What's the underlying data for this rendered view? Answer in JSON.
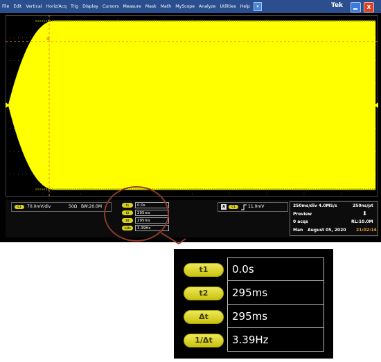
{
  "menu": {
    "items": [
      "File",
      "Edit",
      "Vertical",
      "Horiz/Acq",
      "Trig",
      "Display",
      "Cursors",
      "Measure",
      "Mask",
      "Math",
      "MyScope",
      "Analyze",
      "Utilities",
      "Help"
    ],
    "brand": "Tek",
    "close_glyph": "X"
  },
  "channel": {
    "badge": "C1",
    "scale": "70.0mV/div",
    "impedance": "50Ω",
    "bandwidth": "BW:20.0M"
  },
  "trigger": {
    "mode_badge": "A",
    "source_badge": "C1",
    "level": "11.0mV"
  },
  "acquisition": {
    "timebase": "250ms/div  4.0MS/s",
    "resolution": "250ns/pt",
    "mode": "Preview",
    "acqs": "0 acqs",
    "record_length": "RL:10.0M",
    "state": "Man",
    "date": "August 05, 2020",
    "time": "21:02:14"
  },
  "cursors": [
    {
      "label": "t1",
      "value": "0.0s"
    },
    {
      "label": "t2",
      "value": "295ms"
    },
    {
      "label": "Δt",
      "value": "295ms"
    },
    {
      "label": "1/Δt",
      "value": "3.39Hz"
    }
  ],
  "colors": {
    "trace": "#ffff00",
    "menu_bar": "#2b4f8e",
    "cursor_line": "#e98a24",
    "callout": "#8c3a2a"
  },
  "icons": [
    "minimize-icon",
    "close-icon",
    "dropdown-arrow-icon",
    "trigger-rising-edge-icon",
    "cursor-marker-icon",
    "trigger-position-icon"
  ]
}
